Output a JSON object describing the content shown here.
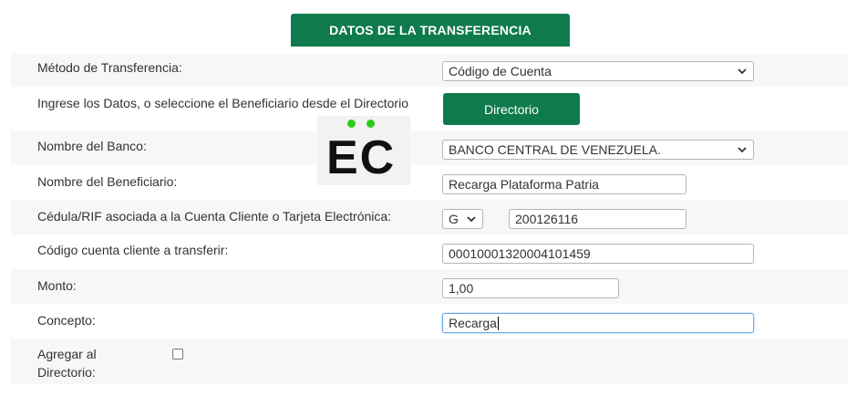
{
  "header": {
    "title": "DATOS DE LA TRANSFERENCIA"
  },
  "form": {
    "metodo": {
      "label": "Método de Transferencia:",
      "value": "Código de Cuenta"
    },
    "directorio": {
      "label": "Ingrese los Datos, o seleccione el Beneficiario desde el Directorio",
      "button": "Directorio"
    },
    "banco": {
      "label": "Nombre del Banco:",
      "value": "BANCO CENTRAL DE VENEZUELA."
    },
    "beneficiario": {
      "label": "Nombre del Beneficiario:",
      "value": "Recarga Plataforma Patria"
    },
    "cedula": {
      "label": "Cédula/RIF asociada a la Cuenta Cliente o Tarjeta Electrónica:",
      "prefix": "G",
      "value": "200126116"
    },
    "codigo": {
      "label": "Código cuenta cliente a transferir:",
      "value": "00010001320004101459"
    },
    "monto": {
      "label": "Monto:",
      "value": "1,00"
    },
    "concepto": {
      "label": "Concepto:",
      "value": "Recarga"
    },
    "agregar": {
      "label_line1": "Agregar al",
      "label_line2": "Directorio:",
      "checked": false
    }
  },
  "overlay_logo": {
    "text": "EC",
    "dot_color": "#2ecc1a"
  },
  "colors": {
    "accent": "#0f7a4c",
    "row_alt": "#f7f7f7",
    "focus": "#6aa9e6"
  }
}
